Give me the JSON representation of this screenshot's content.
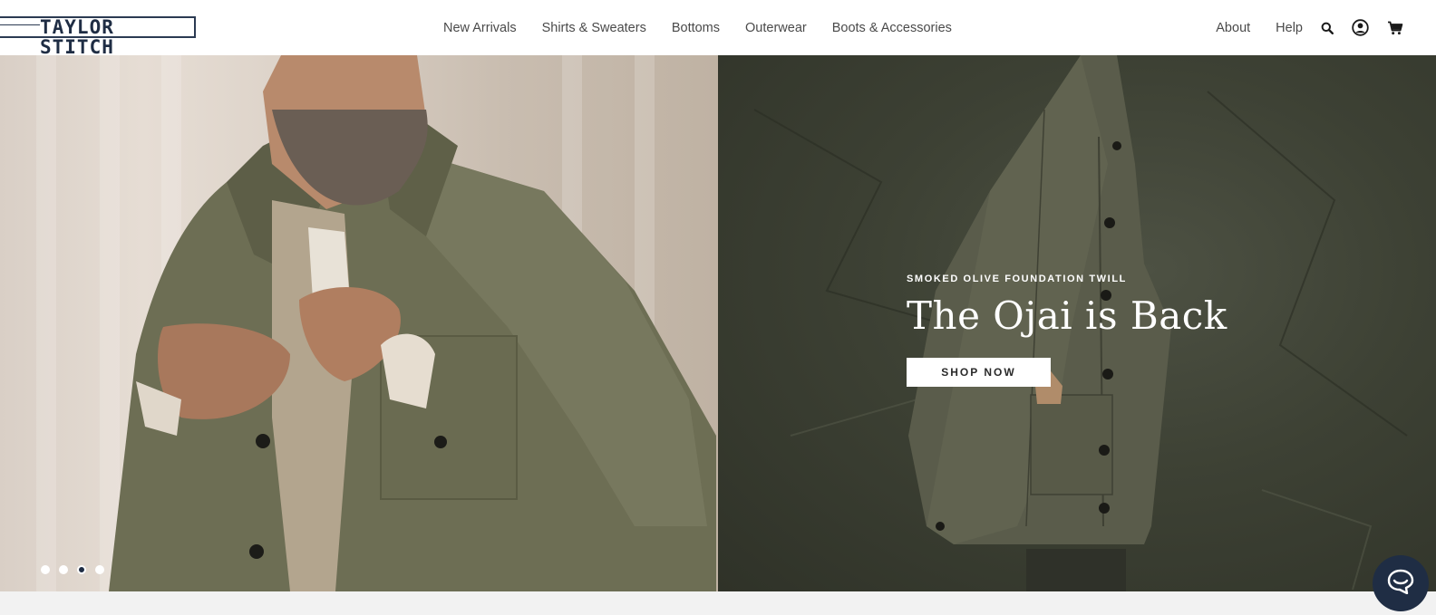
{
  "brand": {
    "name": "TAYLOR STITCH",
    "color": "#1f2d44"
  },
  "nav": {
    "items": [
      {
        "label": "New Arrivals"
      },
      {
        "label": "Shirts & Sweaters"
      },
      {
        "label": "Bottoms"
      },
      {
        "label": "Outerwear"
      },
      {
        "label": "Boots & Accessories"
      }
    ],
    "right": [
      {
        "label": "About"
      },
      {
        "label": "Help"
      }
    ],
    "icons": [
      "search-icon",
      "account-icon",
      "cart-icon"
    ]
  },
  "hero": {
    "eyebrow": "SMOKED OLIVE FOUNDATION TWILL",
    "headline": "The Ojai is Back",
    "cta_label": "SHOP NOW",
    "carousel": {
      "slide_count": 4,
      "active_index": 2
    }
  },
  "chat": {
    "icon": "chat-icon"
  }
}
